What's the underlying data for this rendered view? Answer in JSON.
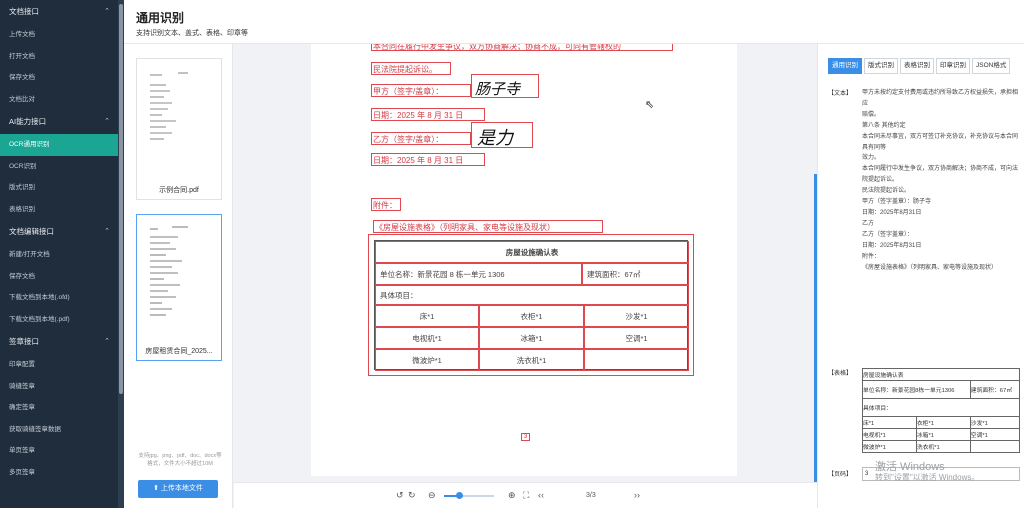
{
  "header": {
    "title": "通用识别",
    "subtitle": "支持识别文本、盖式、表格、印章等"
  },
  "sidebar": {
    "sections": [
      {
        "label": "文档接口",
        "items": [
          "上传文档",
          "打开文档",
          "保存文档",
          "文档比对"
        ]
      },
      {
        "label": "AI能力接口",
        "items": [
          "OCR通用识别",
          "OCR识别",
          "版式识别",
          "表格识别"
        ]
      },
      {
        "label": "文档编辑接口",
        "items": [
          "新建/打开文档",
          "保存文档",
          "下载文档到本地(.ofd)",
          "下载文档到本地(.pdf)"
        ]
      },
      {
        "label": "签章接口",
        "items": [
          "印章配置",
          "骑缝签章",
          "确定签章",
          "获取骑缝签章数据",
          "单页签章",
          "多页签章"
        ]
      }
    ],
    "active_item": "OCR通用识别"
  },
  "thumbnails": [
    {
      "caption": "示例合同.pdf"
    },
    {
      "caption": "房屋租赁合同_2025..."
    }
  ],
  "upload": {
    "hint": "支持jpg、png、pdf、doc、docx等格式，文件大小不超过10M",
    "button": "上传本地文件"
  },
  "document": {
    "lines": [
      "本合同在履行中发生争议，双方协商解决；协商不成，可向有管辖权的",
      "民法院提起诉讼。",
      "甲方（签字/盖章）：",
      "日期：2025 年 8 月 31 日",
      "乙方（签字/盖章）：",
      "日期：2025 年 8 月 31 日",
      "附件：",
      "《房屋设施表格》（列明家具、家电等设施及现状）"
    ],
    "sign_a": "肠子寺",
    "sign_b": "是力",
    "table": {
      "title": "房屋设施确认表",
      "unit": "单位名称：新景花园 8 栋一单元 1306",
      "area": "建筑面积：67㎡",
      "items_label": "具体项目：",
      "rows": [
        [
          "床*1",
          "衣柜*1",
          "沙发*1"
        ],
        [
          "电视机*1",
          "冰箱*1",
          "空调*1"
        ],
        [
          "微波炉*1",
          "洗衣机*1",
          ""
        ]
      ]
    },
    "page_marker": "3"
  },
  "toolbar": {
    "page": "3/3"
  },
  "right_panel": {
    "tabs": [
      "通用识别",
      "版式识别",
      "表格识别",
      "印章识别",
      "JSON格式"
    ],
    "active_tab": "通用识别",
    "text_label": "【文本】",
    "text_lines": [
      "甲方未按约定支付费用或违约所导致乙方权益损失，承担相应",
      "赔偿。",
      "第八条 其他约定",
      "本合同未尽事宜，双方可签订补充协议，补充协议与本合同具有同等",
      "效力。",
      "本合同履行中发生争议，双方协商解决；协商不成，可向法院提起诉讼。",
      "民法院提起诉讼。",
      "甲方（签字盖章）：肠子寺",
      "日期：2025年8月31日",
      "乙方",
      "乙方（签字盖章）：",
      "日期：2025年8月31日",
      "附件：",
      "《房屋设施表格》（列明家具、家电等设施及现状）"
    ],
    "table_label": "【表格】",
    "table_rows": [
      [
        "房屋设施确认表",
        "",
        ""
      ],
      [
        "单位名称：新景花园8栋一单元1306",
        "",
        "建筑面积：67㎡"
      ],
      [
        "具体项目：",
        "",
        ""
      ],
      [
        "床*1",
        "衣柜*1",
        "沙发*1"
      ],
      [
        "电视机*1",
        "冰箱*1",
        "空调*1"
      ],
      [
        "微波炉*1",
        "洗衣机*1",
        ""
      ]
    ],
    "page_label": "【页码】",
    "page_value": "3"
  },
  "watermark": {
    "line1": "激活 Windows",
    "line2": "转到\"设置\"以激活 Windows。"
  }
}
